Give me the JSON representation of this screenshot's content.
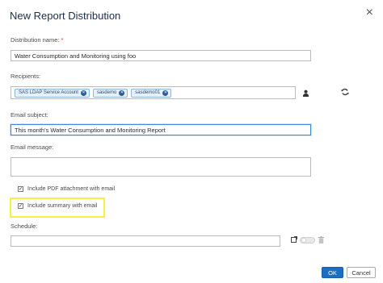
{
  "dialog": {
    "title": "New Report Distribution",
    "close_icon": "close-icon"
  },
  "distribution_name": {
    "label": "Distribution name:",
    "required_marker": "*",
    "value": "Water Consumption and Monitoring using foo"
  },
  "recipients": {
    "label": "Recipients:",
    "chips": [
      {
        "label": "SAS LDAP Service Account"
      },
      {
        "label": "sasdemo"
      },
      {
        "label": "sasdemo01"
      }
    ],
    "user_icon": "user-icon",
    "refresh_icon": "refresh-icon"
  },
  "email_subject": {
    "label": "Email subject:",
    "value": "This month's Water Consumption and Monitoring Report"
  },
  "email_message": {
    "label": "Email message:",
    "value": ""
  },
  "options": {
    "include_pdf": {
      "label": "Include PDF attachment with email",
      "checked": true
    },
    "include_summary": {
      "label": "Include summary with email",
      "checked": true
    }
  },
  "schedule": {
    "label": "Schedule:",
    "value": "",
    "add_icon": "add-schedule-icon",
    "toggle_enabled": false,
    "trash_icon": "trash-icon"
  },
  "footer": {
    "ok_label": "OK",
    "cancel_label": "Cancel"
  },
  "colors": {
    "primary_button": "#1b6fc2",
    "highlight": "#f2f24a",
    "focus_border": "#3d8ad6"
  }
}
